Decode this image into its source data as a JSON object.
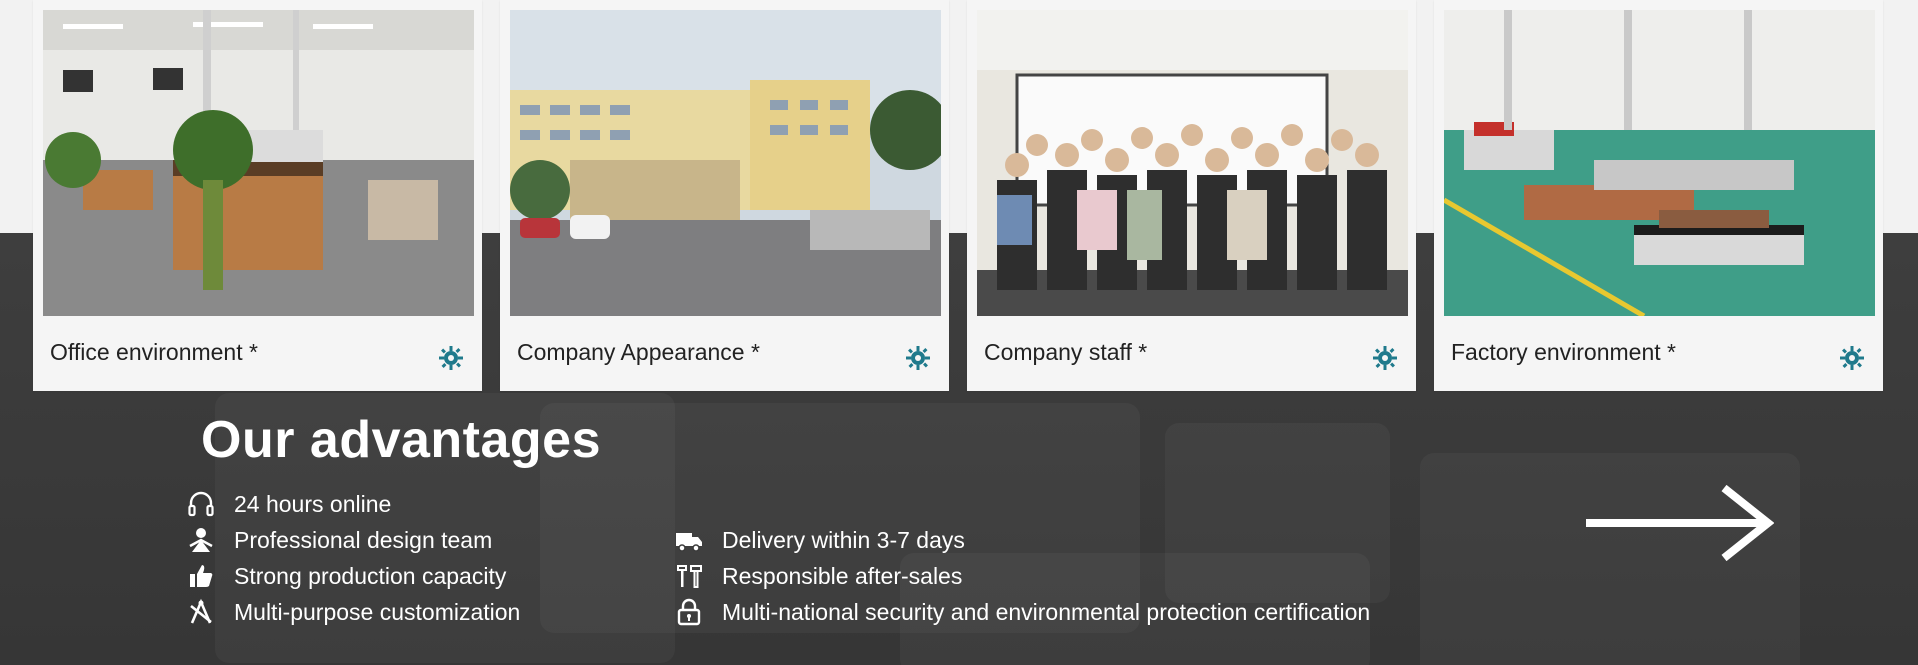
{
  "gallery": {
    "cards": [
      {
        "caption": "Office environment *",
        "icon": "gear-icon"
      },
      {
        "caption": "Company Appearance *",
        "icon": "gear-icon"
      },
      {
        "caption": "Company staff *",
        "icon": "gear-icon"
      },
      {
        "caption": "Factory environment *",
        "icon": "gear-icon"
      }
    ]
  },
  "advantages": {
    "title": "Our advantages",
    "left": [
      {
        "label": "24 hours online",
        "icon": "headphones-icon"
      },
      {
        "label": "Professional design team",
        "icon": "designer-icon"
      },
      {
        "label": "Strong production capacity",
        "icon": "thumbs-up-icon"
      },
      {
        "label": "Multi-purpose customization",
        "icon": "tools-icon"
      }
    ],
    "right": [
      {
        "label": "Delivery within 3-7 days",
        "icon": "truck-icon"
      },
      {
        "label": "Responsible after-sales",
        "icon": "wrench-icon"
      },
      {
        "label": "Multi-national security and environmental protection certification",
        "icon": "lock-icon"
      }
    ],
    "next_icon": "arrow-right-icon"
  },
  "colors": {
    "accent": "#1f7a8c",
    "dark_bg": "#3b3b3b",
    "card_bg": "#f5f5f5"
  }
}
